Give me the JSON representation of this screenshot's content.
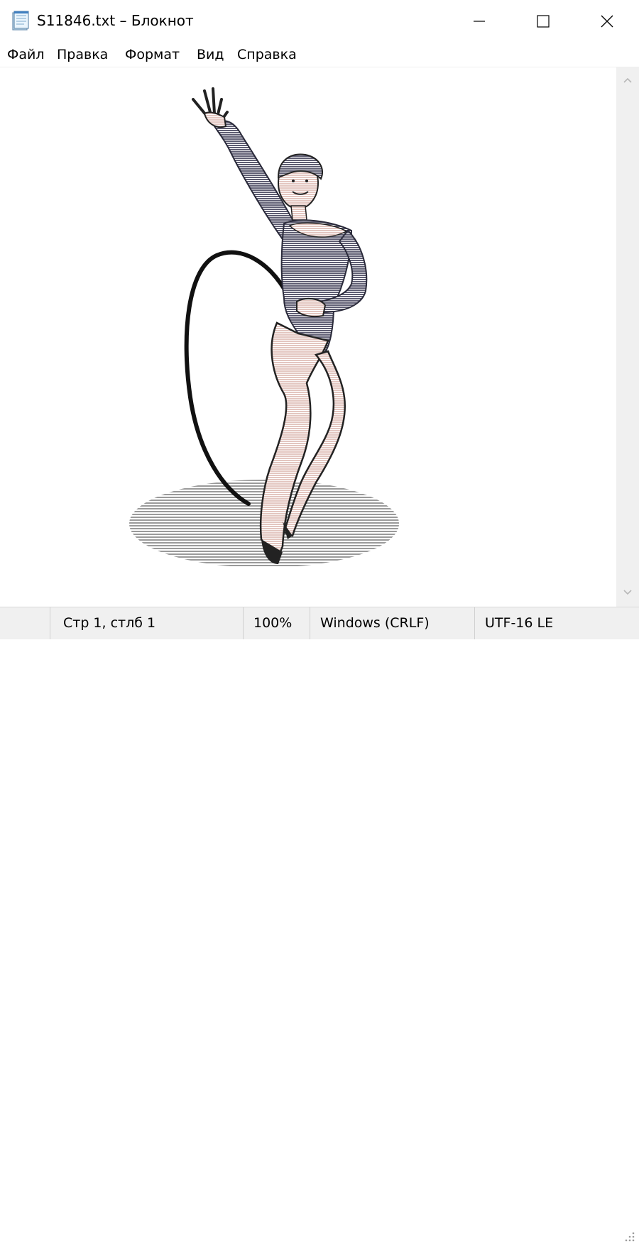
{
  "window": {
    "title": "S11846.txt – Блокнот",
    "icon": "notepad-icon"
  },
  "title_buttons": {
    "minimize_icon": "minimize-icon",
    "maximize_icon": "maximize-icon",
    "close_icon": "close-icon"
  },
  "menu": {
    "items": [
      {
        "label": "Файл"
      },
      {
        "label": "Правка"
      },
      {
        "label": "Формат"
      },
      {
        "label": "Вид"
      },
      {
        "label": "Справка"
      }
    ]
  },
  "editor": {
    "content_description_icon": "ascii-art-gymnast-icon",
    "colors": {
      "body_dark": "#5e5d72",
      "skin": "#e8cfca",
      "ribbon": "#111111",
      "floor": "#9a9a9a"
    }
  },
  "scrollbar": {
    "up_icon": "chevron-up-icon",
    "down_icon": "chevron-down-icon"
  },
  "status": {
    "position": "Стр 1, стлб 1",
    "zoom": "100%",
    "line_ending": "Windows (CRLF)",
    "encoding": "UTF-16 LE"
  },
  "colors": {
    "chrome": "#f0f0f0",
    "background": "#ffffff"
  }
}
